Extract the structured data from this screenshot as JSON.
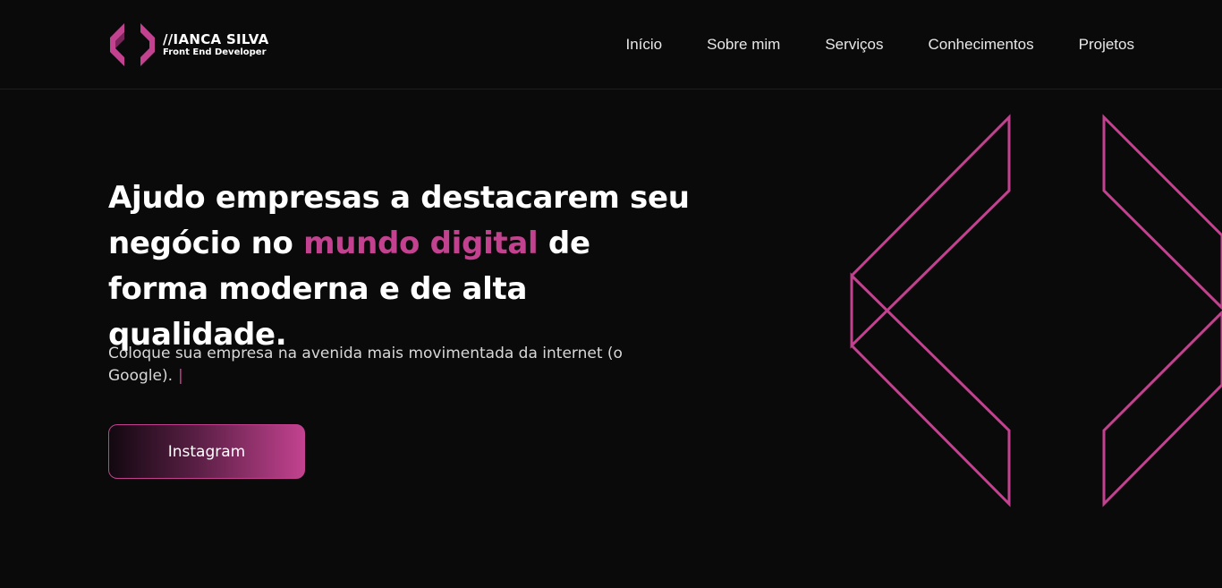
{
  "brand": {
    "name": "//IANCA SILVA",
    "tagline": "Front End Developer",
    "accent_color": "#c2428f"
  },
  "nav": {
    "items": [
      {
        "label": "Início"
      },
      {
        "label": "Sobre mim"
      },
      {
        "label": "Serviços"
      },
      {
        "label": "Conhecimentos"
      },
      {
        "label": "Projetos"
      }
    ]
  },
  "hero": {
    "headline_part1": "Ajudo empresas a destacarem seu negócio no ",
    "headline_accent": "mundo digital",
    "headline_part2": " de forma moderna e de alta qualidade.",
    "subtext": "Coloque sua empresa na avenida mais movimentada da internet (o Google).",
    "cursor": "|",
    "cta_label": "Instagram"
  },
  "decoration": {
    "icon": "code-brackets-icon"
  }
}
